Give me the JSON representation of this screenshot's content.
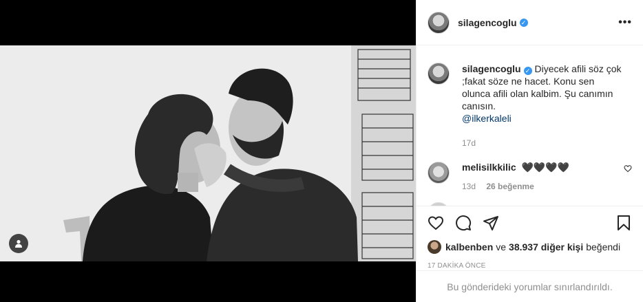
{
  "post": {
    "username": "silagencoglu",
    "more_label": "•••"
  },
  "caption": {
    "username": "silagencoglu",
    "text": "Diyecek afili söz çok ;fakat söze ne hacet. Konu sen olunca afili olan kalbim. Şu canımın canısın.",
    "mention": "@ilkerkaleli",
    "time": "17d"
  },
  "comments": [
    {
      "username": "melisilkkilic",
      "text": "🖤🖤🖤🖤",
      "time": "13d",
      "likes": "26 beğenme"
    }
  ],
  "likes": {
    "user": "kalbenben",
    "connector": "ve",
    "count_text": "38.937 diğer kişi",
    "suffix": "beğendi"
  },
  "timestamp": "17 DAKİKA ÖNCE",
  "comments_limited": "Bu gönderideki yorumlar sınırlandırıldı.",
  "colors": {
    "verified": "#3897f0",
    "link": "#00376b",
    "muted": "#8e8e8e"
  },
  "icons": [
    "user-tag-icon",
    "more-icon",
    "heart-icon",
    "comment-icon",
    "share-icon",
    "bookmark-icon",
    "verified-icon"
  ]
}
